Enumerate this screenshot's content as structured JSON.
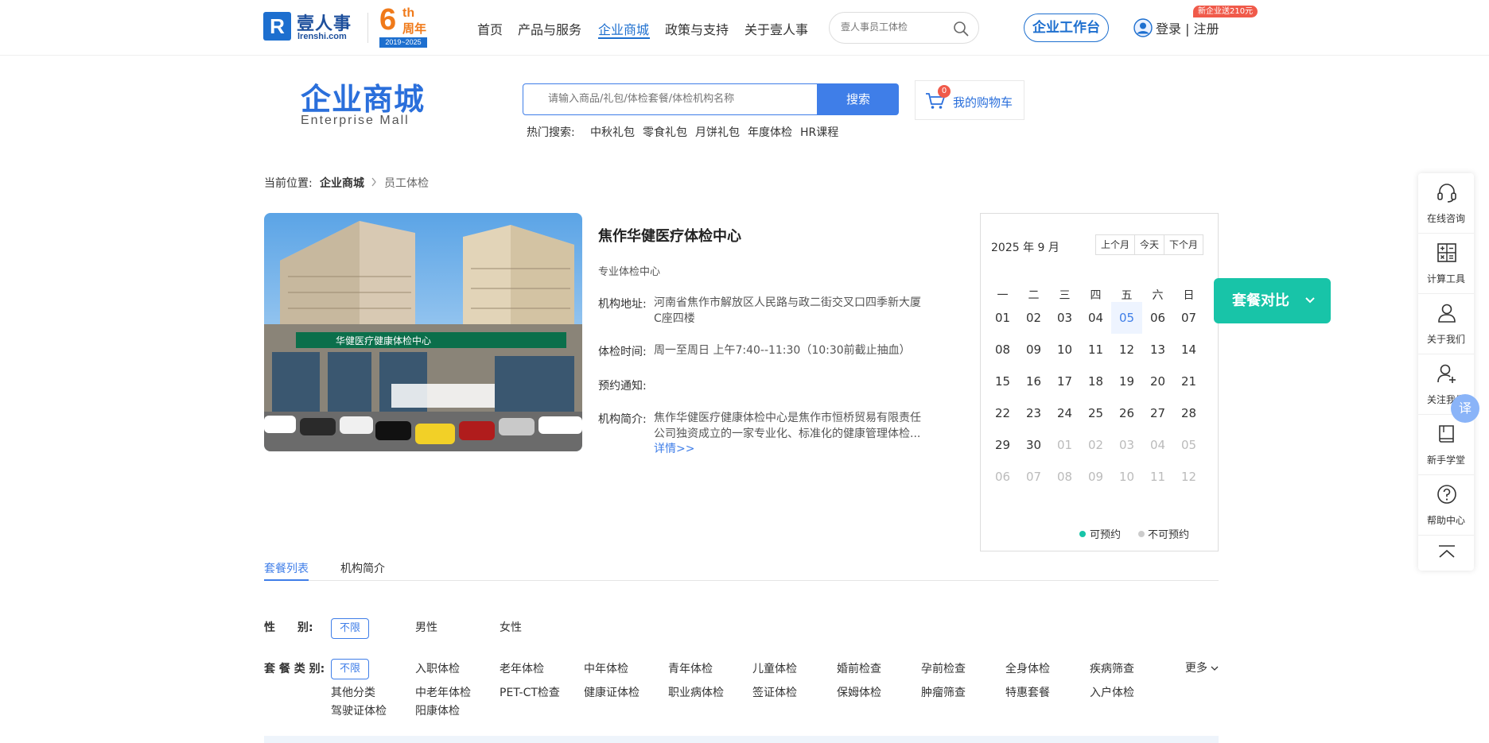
{
  "header": {
    "logo_text": "壹人事",
    "logo_domain": "lrenshi.com",
    "anniversary_num": "6",
    "anniversary_sup": "th",
    "anniversary_word": "周年",
    "anniversary_years": "2019~2025",
    "nav": [
      "首页",
      "产品与服务",
      "企业商城",
      "政策与支持",
      "关于壹人事"
    ],
    "active_nav": "企业商城",
    "search_placeholder": "壹人事员工体检",
    "workbench_label": "企业工作台",
    "login_label": "登录 | 注册",
    "promo_badge": "新企业送210元"
  },
  "mall": {
    "title": "企业商城",
    "subtitle": "Enterprise  Mall",
    "search_placeholder": "请输入商品/礼包/体检套餐/体检机构名称",
    "search_button": "搜索",
    "hot_label": "热门搜索:",
    "hot_items": [
      "中秋礼包",
      "零食礼包",
      "月饼礼包",
      "年度体检",
      "HR课程"
    ],
    "cart_count": "0",
    "cart_label": "我的购物车"
  },
  "breadcrumb": {
    "prefix": "当前位置:",
    "items": [
      "企业商城",
      "员工体检"
    ]
  },
  "institution": {
    "name": "焦作华健医疗体检中心",
    "type": "专业体检中心",
    "address_label": "机构地址:",
    "address": "河南省焦作市解放区人民路与政二街交叉口四季新大厦C座四楼",
    "hours_label": "体检时间:",
    "hours": "周一至周日 上午7:40--11:30（10:30前截止抽血）",
    "notice_label": "预约通知:",
    "notice": "",
    "intro_label": "机构简介:",
    "intro": "焦作华健医疗健康体检中心是焦作市恒桥贸易有限责任公司独资成立的一家专业化、标准化的健康管理体检...",
    "detail_link": "详情>>",
    "photo_sign_text": "华健医疗健康体检中心"
  },
  "calendar": {
    "title": "2025 年 9 月",
    "buttons": [
      "上个月",
      "今天",
      "下个月"
    ],
    "weekdays": [
      "一",
      "二",
      "三",
      "四",
      "五",
      "六",
      "日"
    ],
    "days": [
      "01",
      "02",
      "03",
      "04",
      "05",
      "06",
      "07",
      "08",
      "09",
      "10",
      "11",
      "12",
      "13",
      "14",
      "15",
      "16",
      "17",
      "18",
      "19",
      "20",
      "21",
      "22",
      "23",
      "24",
      "25",
      "26",
      "27",
      "28",
      "29",
      "30",
      "01",
      "02",
      "03",
      "04",
      "05",
      "06",
      "07",
      "08",
      "09",
      "10",
      "11",
      "12"
    ],
    "current_month_count": 30,
    "highlight_day": "05",
    "legend_available": "可预约",
    "legend_unavailable": "不可预约",
    "color_available": "#18c4a8",
    "color_unavailable": "#cccccc"
  },
  "compare_button": "套餐对比",
  "sidebar": {
    "items": [
      "在线咨询",
      "计算工具",
      "关于我们",
      "关注我们",
      "新手学堂",
      "帮助中心"
    ],
    "translate_badge": "译"
  },
  "tabs": [
    "套餐列表",
    "机构简介"
  ],
  "filters": {
    "gender_label": "性　　别:",
    "gender_options": [
      "不限",
      "男性",
      "女性"
    ],
    "category_label": "套 餐 类 别:",
    "category_options": [
      "不限",
      "入职体检",
      "老年体检",
      "中年体检",
      "青年体检",
      "儿童体检",
      "婚前检查",
      "孕前检查",
      "全身体检",
      "疾病筛查",
      "其他分类",
      "中老年体检",
      "PET-CT检查",
      "健康证体检",
      "职业病体检",
      "签证体检",
      "保姆体检",
      "肿瘤筛查",
      "特惠套餐",
      "入户体检",
      "驾驶证体检",
      "阳康体检"
    ],
    "more_label": "更多"
  },
  "colors": {
    "brand_blue": "#1d6fcf",
    "accent_blue": "#3f7ee8",
    "teal": "#18c4a8",
    "promo_red": "#f05a4a",
    "anniversary_orange": "#f07a1a"
  }
}
